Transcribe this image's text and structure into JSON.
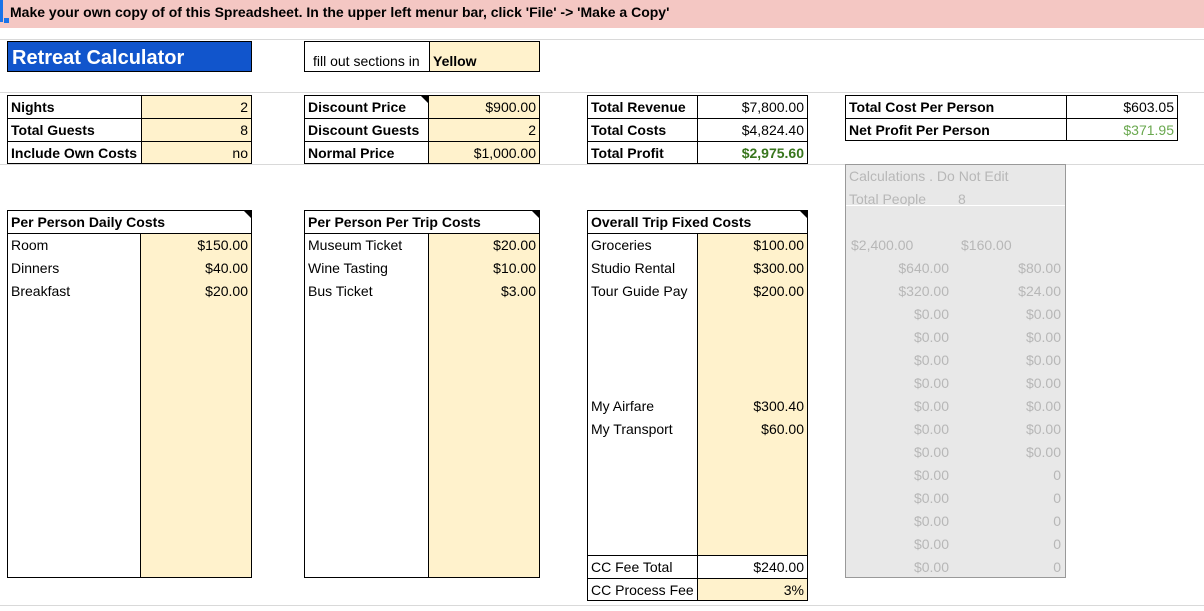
{
  "banner": "Make your own copy of of this Spreadsheet.  In the upper left menur bar, click 'File' -> 'Make a Copy'",
  "title": "Retreat Calculator",
  "instruction": {
    "prefix": "fill out sections in",
    "highlight": "Yellow"
  },
  "inputs": [
    {
      "label": "Nights",
      "value": "2"
    },
    {
      "label": "Total Guests",
      "value": "8"
    },
    {
      "label": "Include Own Costs",
      "value": "no"
    }
  ],
  "pricing": [
    {
      "label": "Discount Price",
      "value": "$900.00"
    },
    {
      "label": "Discount Guests",
      "value": "2"
    },
    {
      "label": "Normal Price",
      "value": "$1,000.00"
    }
  ],
  "totals": [
    {
      "label": "Total Revenue",
      "value": "$7,800.00"
    },
    {
      "label": "Total Costs",
      "value": "$4,824.40"
    },
    {
      "label": "Total Profit",
      "value": "$2,975.60"
    }
  ],
  "per_person": [
    {
      "label": "Total Cost Per Person",
      "value": "$603.05"
    },
    {
      "label": "Net Profit Per Person",
      "value": "$371.95"
    }
  ],
  "daily_costs": {
    "header": "Per Person Daily Costs",
    "rows": [
      {
        "label": "Room",
        "value": "$150.00"
      },
      {
        "label": "Dinners",
        "value": "$40.00"
      },
      {
        "label": "Breakfast",
        "value": "$20.00"
      }
    ]
  },
  "trip_costs": {
    "header": "Per Person Per Trip Costs",
    "rows": [
      {
        "label": "Museum Ticket",
        "value": "$20.00"
      },
      {
        "label": "Wine Tasting",
        "value": "$10.00"
      },
      {
        "label": "Bus Ticket",
        "value": "$3.00"
      }
    ]
  },
  "fixed_costs": {
    "header": "Overall Trip Fixed Costs",
    "rows": [
      {
        "label": "Groceries",
        "value": "$100.00"
      },
      {
        "label": "Studio Rental",
        "value": "$300.00"
      },
      {
        "label": "Tour Guide Pay",
        "value": "$200.00"
      },
      {
        "label": "",
        "value": ""
      },
      {
        "label": "",
        "value": ""
      },
      {
        "label": "",
        "value": ""
      },
      {
        "label": "",
        "value": ""
      },
      {
        "label": "My Airfare",
        "value": "$300.40"
      },
      {
        "label": "My Transport",
        "value": "$60.00"
      }
    ],
    "cc_fee_total_label": "CC Fee Total",
    "cc_fee_total": "$240.00",
    "cc_process_fee_label": "CC Process Fee",
    "cc_process_fee": "3%"
  },
  "calculations": {
    "header": "Calculations . Do Not Edit",
    "total_people_label": "Total People",
    "total_people": "8",
    "col_a": [
      "$2,400.00",
      "$640.00",
      "$320.00",
      "$0.00",
      "$0.00",
      "$0.00",
      "$0.00",
      "$0.00",
      "$0.00",
      "$0.00",
      "$0.00",
      "$0.00",
      "$0.00",
      "$0.00",
      "$0.00"
    ],
    "col_b": [
      "$160.00",
      "$80.00",
      "$24.00",
      "$0.00",
      "$0.00",
      "$0.00",
      "$0.00",
      "$0.00",
      "$0.00",
      "$0.00",
      "0",
      "0",
      "0",
      "0",
      "0"
    ]
  },
  "colors": {
    "input_yellow": "#fff2cc",
    "title_blue": "#1155cc",
    "banner_pink": "#f4c7c3",
    "profit_green": "#38761d"
  }
}
